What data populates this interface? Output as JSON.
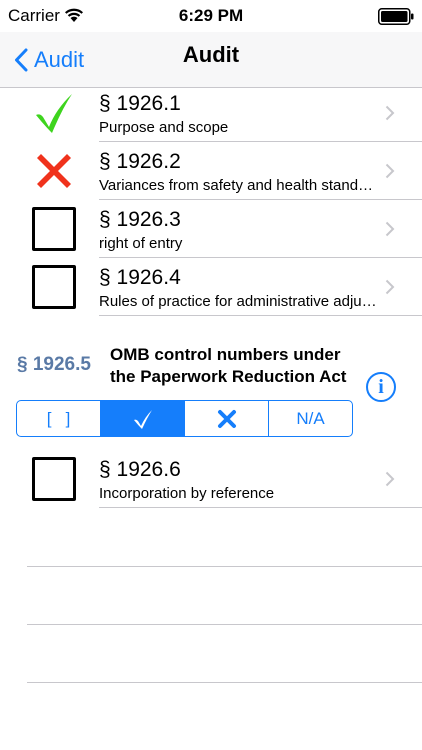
{
  "status_bar": {
    "carrier": "Carrier",
    "time": "6:29 PM"
  },
  "nav": {
    "back_label": "Audit",
    "title": "Audit"
  },
  "items": [
    {
      "code": "§ 1926.1",
      "desc": "Purpose and scope",
      "status": "pass"
    },
    {
      "code": "§ 1926.2",
      "desc": "Variances from safety and health standards",
      "status": "fail"
    },
    {
      "code": "§ 1926.3",
      "desc": "right of entry",
      "status": "unchecked"
    },
    {
      "code": "§ 1926.4",
      "desc": "Rules of practice for administrative adjudications",
      "status": "unchecked"
    }
  ],
  "expanded_item": {
    "code": "§ 1926.5",
    "title": "OMB control numbers under the Paperwork Reduction Act",
    "info_glyph": "i",
    "options": [
      {
        "label": "[   ]",
        "selected": false
      },
      {
        "label": "",
        "icon": "checkmark-icon",
        "selected": true
      },
      {
        "label": "",
        "icon": "x-mark-icon",
        "selected": false
      },
      {
        "label": "N/A",
        "selected": false
      }
    ]
  },
  "items_after": [
    {
      "code": "§ 1926.6",
      "desc": "Incorporation by reference",
      "status": "unchecked"
    }
  ],
  "colors": {
    "accent": "#157efb",
    "pass_green": "#3ed41e",
    "fail_red": "#f0321c",
    "section_code": "#5a7aa6"
  }
}
